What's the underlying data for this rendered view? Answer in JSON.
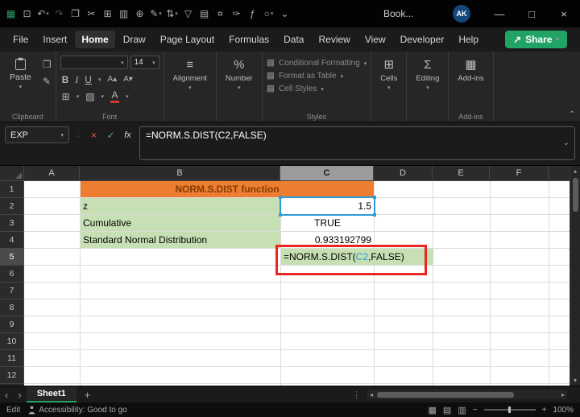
{
  "colors": {
    "accent_green": "#21A366",
    "header_fill": "#ED7D31",
    "header_text": "#833C00",
    "green_fill": "#C6E0B4",
    "ref_blue": "#2E9BD6",
    "annotation_red": "#E8251F"
  },
  "icons": {
    "share": "↗",
    "caret_down": "▾",
    "chevron_down": "⌄",
    "chevron_up": "⌃",
    "minimize": "—",
    "maximize": "□",
    "close": "×",
    "cancel": "×",
    "enter": "✓",
    "fx": "fx",
    "bold": "B",
    "italic": "I",
    "underline": "U",
    "font_grow": "A▴",
    "font_shrink": "A▾",
    "borders": "⊞",
    "fill": "▨",
    "font_color": "A",
    "align": "≡",
    "percent": "%",
    "styles_icon": "▦",
    "cells": "⊞",
    "editing": "Σ",
    "addins": "▦",
    "copy": "❐",
    "painter": "✎",
    "scroll_up": "▴",
    "scroll_down": "▾",
    "scroll_left": "◂",
    "scroll_right": "▸",
    "sheet_prev": "‹",
    "sheet_next": "›",
    "add_sheet": "+",
    "grip": "⋮",
    "view_normal": "▦",
    "view_layout": "▤",
    "view_break": "▥",
    "zoom_out": "−",
    "zoom_in": "+"
  },
  "title_bar": {
    "document_title": "Book...",
    "avatar_initials": "AK",
    "quick_access_icons": [
      {
        "name": "app-launcher-icon",
        "glyph": "▦",
        "color": "#21A366"
      },
      {
        "name": "save-icon",
        "glyph": "⊡"
      },
      {
        "name": "undo-icon",
        "glyph": "↶",
        "caret": true
      },
      {
        "name": "redo-icon",
        "glyph": "↷",
        "dim": true
      },
      {
        "name": "copy-icon",
        "glyph": "❐"
      },
      {
        "name": "cut-icon",
        "glyph": "✂"
      },
      {
        "name": "table-icon",
        "glyph": "⊞"
      },
      {
        "name": "chart-icon",
        "glyph": "▥"
      },
      {
        "name": "globe-icon",
        "glyph": "⊕"
      },
      {
        "name": "draw-icon",
        "glyph": "✎",
        "caret": true
      },
      {
        "name": "sort-icon",
        "glyph": "⇅",
        "caret": true
      },
      {
        "name": "filter-icon",
        "glyph": "▽"
      },
      {
        "name": "grid-icon",
        "glyph": "▤"
      },
      {
        "name": "currency-icon",
        "glyph": "¤"
      },
      {
        "name": "brush-icon",
        "glyph": "✑"
      },
      {
        "name": "function-icon",
        "glyph": "ƒ"
      },
      {
        "name": "record-icon",
        "glyph": "○",
        "caret": true
      },
      {
        "name": "qat-overflow-icon",
        "glyph": "⌄"
      }
    ]
  },
  "menu_bar": {
    "tabs": [
      "File",
      "Insert",
      "Home",
      "Draw",
      "Page Layout",
      "Formulas",
      "Data",
      "Review",
      "View",
      "Developer",
      "Help"
    ],
    "active_index": 2,
    "share_label": "Share"
  },
  "ribbon": {
    "paste_label": "Paste",
    "clipboard_group": "Clipboard",
    "font_name": "",
    "font_size": "14",
    "font_group": "Font",
    "alignment_label": "Alignment",
    "number_label": "Number",
    "conditional_label": "Conditional Formatting",
    "format_table_label": "Format as Table",
    "cell_styles_label": "Cell Styles",
    "styles_group": "Styles",
    "cells_label": "Cells",
    "editing_label": "Editing",
    "addins_label": "Add-ins",
    "addins_group": "Add-ins"
  },
  "formula_bar": {
    "name_box": "EXP",
    "formula": "=NORM.S.DIST(C2,FALSE)"
  },
  "grid": {
    "column_headers": [
      "A",
      "B",
      "C",
      "D",
      "E",
      "F"
    ],
    "active_column": "C",
    "row_headers": [
      "1",
      "2",
      "3",
      "4",
      "5",
      "6",
      "7",
      "8",
      "9",
      "10",
      "11",
      "12"
    ],
    "active_row": "5",
    "cells": {
      "title": "NORM.S.DIST function",
      "z_label": "z",
      "z_value": "1.5",
      "cumulative_label": "Cumulative",
      "cumulative_value": "TRUE",
      "snd_label": "Standard Normal Distribution",
      "snd_value": "0.933192799",
      "c5_prefix": "=NORM.S.DIST(",
      "c5_ref": "C2",
      "c5_suffix": ",FALSE)"
    }
  },
  "sheet_bar": {
    "active_sheet": "Sheet1"
  },
  "status_bar": {
    "mode": "Edit",
    "accessibility": "Accessibility: Good to go",
    "zoom_level": "100%"
  }
}
